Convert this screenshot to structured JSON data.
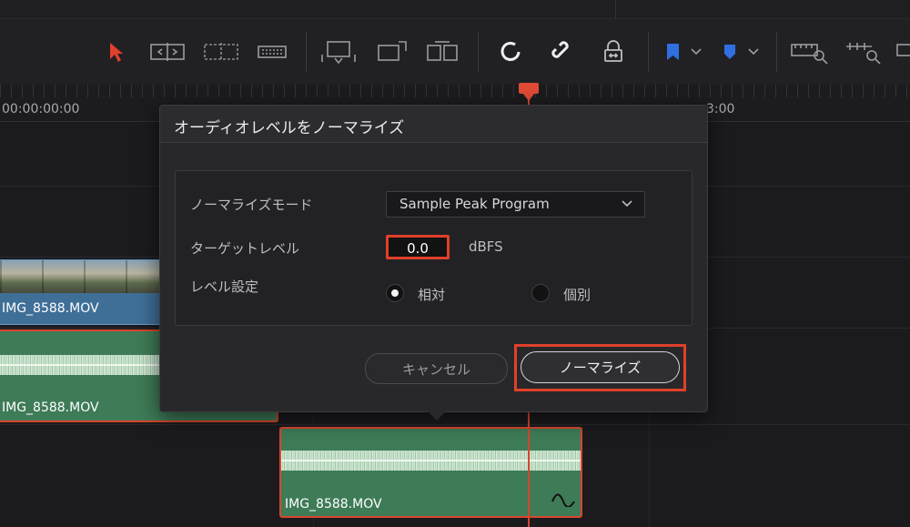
{
  "timeline": {
    "timecode_start": "00:00:00:00",
    "timecode_right": "3:00",
    "clips": {
      "video_label": "IMG_8588.MOV",
      "audio1_label": "IMG_8588.MOV",
      "audio2_label": "IMG_8588.MOV"
    }
  },
  "toolbar": {
    "icons": [
      "select-arrow-icon",
      "trim-icon",
      "dynamic-trim-icon",
      "blade-icon",
      "insert-icon",
      "overwrite-icon",
      "replace-icon",
      "snapping-icon",
      "linked-selection-icon",
      "position-lock-icon",
      "flag-icon",
      "marker-icon",
      "zoom-full-icon",
      "zoom-detail-icon",
      "zoom-custom-icon"
    ],
    "accent_colors": {
      "select": "#e0402a",
      "flag": "#2f6fe0",
      "marker": "#2f6fe0"
    }
  },
  "dialog": {
    "title": "オーディオレベルをノーマライズ",
    "mode_label": "ノーマライズモード",
    "mode_value": "Sample Peak Program",
    "target_label": "ターゲットレベル",
    "target_value": "0.0",
    "target_unit": "dBFS",
    "level_label": "レベル設定",
    "option_relative": "相対",
    "option_individual": "個別",
    "selected_option": "相対",
    "cancel_label": "キャンセル",
    "normalize_label": "ノーマライズ"
  },
  "colors": {
    "highlight": "#e0402a",
    "video_clip": "#3f6f97",
    "audio_clip": "#3e7b57"
  }
}
